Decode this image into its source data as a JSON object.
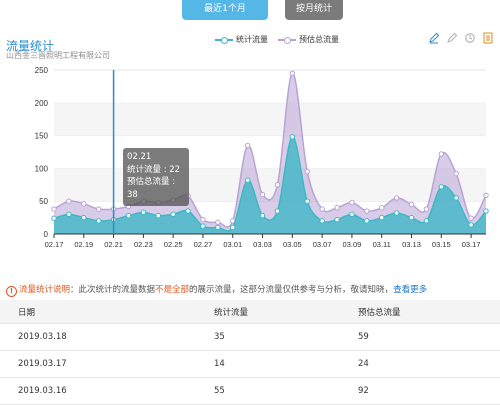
{
  "tabs": {
    "recent_label": "最近1个月",
    "monthly_label": "按月统计"
  },
  "chart": {
    "title": "流量统计",
    "subtitle": "山西金三晋照明工程有限公司",
    "legend": [
      "统计流量",
      "预估总流量"
    ],
    "colors": {
      "stat": "#3fb7c6",
      "total": "#b9a3d6"
    },
    "tooltip": {
      "date": "02.21",
      "line1": "统计流量 : 22",
      "line2": "预估总流量 : 38"
    },
    "toolbox_icons": [
      "pencil-icon",
      "eraser-icon",
      "refresh-icon",
      "data-view-icon"
    ]
  },
  "chart_data": {
    "type": "area",
    "x": [
      "02.17",
      "02.18",
      "02.19",
      "02.20",
      "02.21",
      "02.22",
      "02.23",
      "02.24",
      "02.25",
      "02.26",
      "02.27",
      "02.28",
      "03.01",
      "03.02",
      "03.03",
      "03.04",
      "03.05",
      "03.06",
      "03.07",
      "03.08",
      "03.09",
      "03.10",
      "03.11",
      "03.12",
      "03.13",
      "03.14",
      "03.15",
      "03.16",
      "03.17",
      "03.18"
    ],
    "xticks": [
      "02.17",
      "02.19",
      "02.21",
      "02.23",
      "02.25",
      "02.27",
      "03.01",
      "03.03",
      "03.05",
      "03.07",
      "03.09",
      "03.11",
      "03.13",
      "03.15",
      "03.17"
    ],
    "series": [
      {
        "name": "统计流量",
        "values": [
          24,
          30,
          25,
          20,
          22,
          28,
          33,
          28,
          30,
          35,
          12,
          10,
          10,
          82,
          28,
          35,
          148,
          50,
          20,
          22,
          30,
          20,
          25,
          32,
          25,
          20,
          72,
          55,
          14,
          35
        ]
      },
      {
        "name": "预估总流量",
        "values": [
          38,
          50,
          46,
          38,
          38,
          42,
          50,
          48,
          52,
          58,
          22,
          18,
          20,
          135,
          60,
          75,
          245,
          95,
          38,
          40,
          48,
          35,
          40,
          55,
          45,
          38,
          122,
          92,
          24,
          59
        ]
      }
    ],
    "ylim": [
      0,
      250
    ],
    "yticks": [
      0,
      50,
      100,
      150,
      200,
      250
    ],
    "grid": true,
    "legend_position": "top-center"
  },
  "notice": {
    "label": "流量统计说明",
    "text_a": "：此次统计的流量数据",
    "highlight": "不是全部",
    "text_b": "的展示流量，这部分流量仅供参考与分析，敬请知晓，",
    "link": "查看更多"
  },
  "table": {
    "headers": [
      "日期",
      "统计流量",
      "预估总流量"
    ],
    "rows": [
      [
        "2019.03.18",
        "35",
        "59"
      ],
      [
        "2019.03.17",
        "14",
        "24"
      ],
      [
        "2019.03.16",
        "55",
        "92"
      ]
    ]
  }
}
